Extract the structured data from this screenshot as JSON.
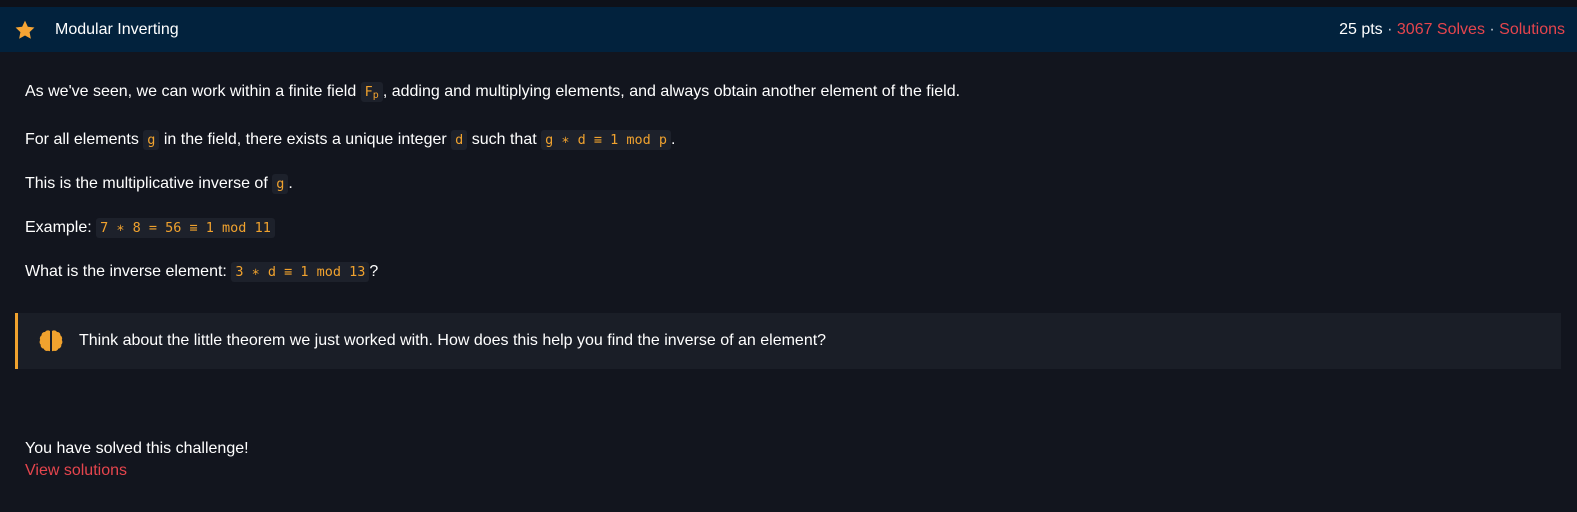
{
  "header": {
    "title": "Modular Inverting",
    "points": "25 pts",
    "separator": " · ",
    "solves": "3067 Solves",
    "solutions": "Solutions",
    "icon": "star-icon"
  },
  "body": {
    "p1_a": "As we've seen, we can work within a finite field ",
    "p1_field": "F",
    "p1_field_sub": "p",
    "p1_b": ", adding and multiplying elements, and always obtain another element of the field.",
    "p2_a": "For all elements ",
    "p2_g": "g",
    "p2_b": " in the field, there exists a unique integer ",
    "p2_d": "d",
    "p2_c": " such that ",
    "p2_expr": "g ∗ d ≡ 1 mod p",
    "p2_end": ".",
    "p3_a": "This is the multiplicative inverse of ",
    "p3_g": "g",
    "p3_end": ".",
    "p4_label": "Example: ",
    "p4_expr": "7 ∗ 8 = 56 ≡ 1 mod 11",
    "p5_a": "What is the inverse element: ",
    "p5_expr": "3 ∗ d ≡ 1 mod 13",
    "p5_end": "?"
  },
  "hint": {
    "icon": "brain-icon",
    "text": "Think about the little theorem we just worked with. How does this help you find the inverse of an element?"
  },
  "footer": {
    "solved_text": "You have solved this challenge!",
    "view_solutions": "View solutions"
  },
  "colors": {
    "header_bg": "#02223d",
    "page_bg": "#12151e",
    "accent_orange": "#f0a22e",
    "accent_red": "#e5454d"
  }
}
